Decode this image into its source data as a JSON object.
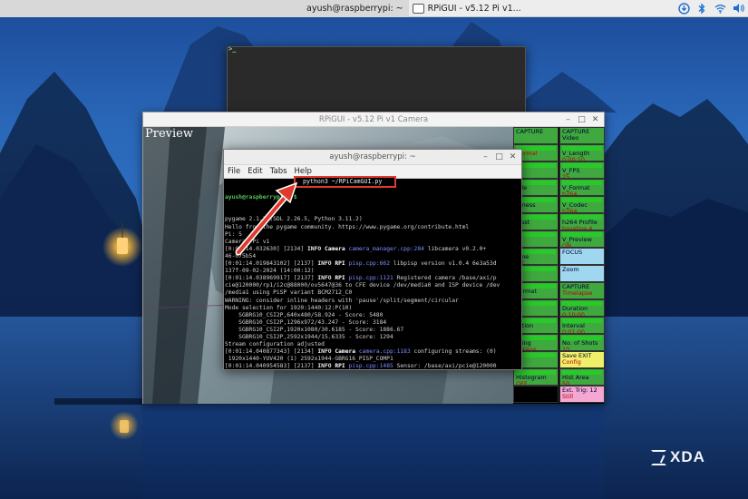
{
  "taskbar": {
    "tasks": [
      {
        "label": "ayush@raspberrypi: ~",
        "icon": "terminal-icon",
        "active": true
      },
      {
        "label": "RPiGUI - v5.12  Pi v1...",
        "icon": "window-icon",
        "active": false
      }
    ],
    "tray": [
      "update-icon",
      "bluetooth-icon",
      "wifi-icon",
      "speaker-icon"
    ]
  },
  "rpigui": {
    "title": "RPiGUI - v5.12  Pi v1 Camera",
    "preview_label": "Preview",
    "grid": [
      {
        "col": 0,
        "row": 0,
        "l1": "CAPTURE",
        "l2": "",
        "color": "green"
      },
      {
        "col": 1,
        "row": 0,
        "l1": "CAPTURE Video",
        "l2": "",
        "color": "green"
      },
      {
        "col": 0,
        "row": 1,
        "l1": "",
        "l2": "Normal",
        "color": "bar"
      },
      {
        "col": 1,
        "row": 1,
        "l1": "V_Length",
        "l2": "0:00:10",
        "color": "bar"
      },
      {
        "col": 0,
        "row": 2,
        "l1": "",
        "l2": "",
        "color": "bar"
      },
      {
        "col": 1,
        "row": 2,
        "l1": "V_FPS",
        "l2": "25",
        "color": "bar"
      },
      {
        "col": 0,
        "row": 3,
        "l1": "ode",
        "l2": "",
        "color": "bar"
      },
      {
        "col": 1,
        "row": 3,
        "l1": "V_Format",
        "l2": "h264",
        "color": "bar"
      },
      {
        "col": 0,
        "row": 4,
        "l1": "htness",
        "l2": "0",
        "color": "bar"
      },
      {
        "col": 1,
        "row": 4,
        "l1": "V_Codec",
        "l2": "h264",
        "color": "bar"
      },
      {
        "col": 0,
        "row": 5,
        "l1": "trast",
        "l2": "0",
        "color": "bar"
      },
      {
        "col": 1,
        "row": 5,
        "l1": "h264 Profile",
        "l2": "baseline 4",
        "color": "bar"
      },
      {
        "col": 0,
        "row": 6,
        "l1": "",
        "l2": "",
        "color": "bar"
      },
      {
        "col": 1,
        "row": 6,
        "l1": "V_Preview",
        "l2": "ON",
        "color": "bar"
      },
      {
        "col": 0,
        "row": 7,
        "l1": "ome",
        "l2": "off",
        "color": "bar"
      },
      {
        "col": 1,
        "row": 7,
        "l1": "FOCUS",
        "l2": "",
        "color": "lblue"
      },
      {
        "col": 0,
        "row": 8,
        "l1": "",
        "l2": "",
        "color": "bar"
      },
      {
        "col": 1,
        "row": 8,
        "l1": "Zoom",
        "l2": "",
        "color": "lblue"
      },
      {
        "col": 0,
        "row": 9,
        "l1": "Format",
        "l2": "",
        "color": "bar"
      },
      {
        "col": 1,
        "row": 9,
        "l1": "CAPTURE",
        "l2": "Timelapse",
        "color": "green"
      },
      {
        "col": 0,
        "row": 10,
        "l1": "",
        "l2": "",
        "color": "bar"
      },
      {
        "col": 1,
        "row": 10,
        "l1": "Duration",
        "l2": "0:10:00",
        "color": "bar"
      },
      {
        "col": 0,
        "row": 11,
        "l1": "ration",
        "l2": "",
        "color": "bar"
      },
      {
        "col": 1,
        "row": 11,
        "l1": "Interval",
        "l2": "0:01:00",
        "color": "bar"
      },
      {
        "col": 0,
        "row": 12,
        "l1": "ering",
        "l2": "verage",
        "color": "bar"
      },
      {
        "col": 1,
        "row": 12,
        "l1": "No. of Shots",
        "l2": "10",
        "color": "bar"
      },
      {
        "col": 0,
        "row": 13,
        "l1": "",
        "l2": "",
        "color": "bar"
      },
      {
        "col": 1,
        "row": 13,
        "l1": "Save    EXIT",
        "l2": "Config",
        "color": "yellow"
      },
      {
        "col": 0,
        "row": 14,
        "l1": "Histogram",
        "l2": "OFF",
        "color": "bar"
      },
      {
        "col": 1,
        "row": 14,
        "l1": "Hist Area",
        "l2": "50",
        "color": "bar"
      },
      {
        "col": 0,
        "row": 15,
        "l1": "",
        "l2": "",
        "color": "black"
      },
      {
        "col": 1,
        "row": 15,
        "l1": "Ext. Trig:  12",
        "l2": "Still",
        "color": "pink"
      }
    ]
  },
  "terminal": {
    "title": "ayush@raspberrypi: ~",
    "menu": [
      "File",
      "Edit",
      "Tabs",
      "Help"
    ],
    "prompt": "ayush@raspberrypi:~ $",
    "command": "python3 ~/RPiCamGUI.py",
    "lines": [
      {
        "text": "pygame 2.1.2 (SDL 2.26.5, Python 3.11.2)"
      },
      {
        "text": "Hello from the pygame community. https://www.pygame.org/contribute.html"
      },
      {
        "text": "Pi: 5"
      },
      {
        "text": "Camera: Pi v1"
      },
      {
        "pre": "[0:01:14.0",
        "ts": "32630] [2134] ",
        "info": "INFO",
        "mod": " Camera ",
        "src": "camera_manager.cpp:284",
        "post": " libcamera v0.2.0+"
      },
      {
        "text": "46-075b54"
      },
      {
        "pre": "[0:01:14.0",
        "ts": "19843102] [2137] ",
        "info": "INFO",
        "mod": " RPI ",
        "src": "pisp.cpp:662",
        "post": " libpisp version v1.0.4 6e3a53d"
      },
      {
        "text": "137f-09-02-2024 (14:00:12)"
      },
      {
        "pre": "[0:01:14.0",
        "ts": "38969917] [2137] ",
        "info": "INFO",
        "mod": " RPI ",
        "src": "pisp.cpp:1121",
        "post": " Registered camera /base/axi/p"
      },
      {
        "text": "cie@120000/rp1/i2c@88000/ov5647@36 to CFE device /dev/media0 and ISP device /dev"
      },
      {
        "text": "/media1 using PiSP variant BCM2712_C0"
      },
      {
        "text": "WARNING: consider inline headers with 'pause'/split/segment/circular"
      },
      {
        "text": "Mode selection for 1920:1440:12:P(10)"
      },
      {
        "text": "    SGBRG10_CSI2P,640x480/58.924 - Score: 5480"
      },
      {
        "text": "    SGBRG10_CSI2P,1296x972/43.247 - Score: 3184"
      },
      {
        "text": "    SGBRG10_CSI2P,1920x1080/30.6185 - Score: 1886.67"
      },
      {
        "text": "    SGBRG10_CSI2P,2592x1944/15.6335 - Score: 1294"
      },
      {
        "text": "Stream configuration adjusted"
      },
      {
        "pre": "[0:01:14.0",
        "ts": "40877343] [2134] ",
        "info": "INFO",
        "mod": " Camera ",
        "src": "camera.cpp:1183",
        "post": " configuring streams: (0)"
      },
      {
        "text": " 1920x1440-YUV420 (1) 2592x1944-GBRG16_PISP_COMP1"
      },
      {
        "pre": "[0:01:14.0",
        "ts": "40954583] [2137] ",
        "info": "INFO",
        "mod": " RPI ",
        "src": "pisp.cpp:1485",
        "post": " Sensor: /base/axi/pcie@120000"
      },
      {
        "text": "/rp1/i2c@88000/ov5647@36 - Selected sensor format: 2592x1944-SGBRG10_1X10 - Sele"
      },
      {
        "text": "cted CFE format: 2592x1944-PC1g"
      }
    ]
  },
  "annotation": {
    "arrow_color": "#e03a2e"
  },
  "watermark": {
    "text": "XDA"
  }
}
